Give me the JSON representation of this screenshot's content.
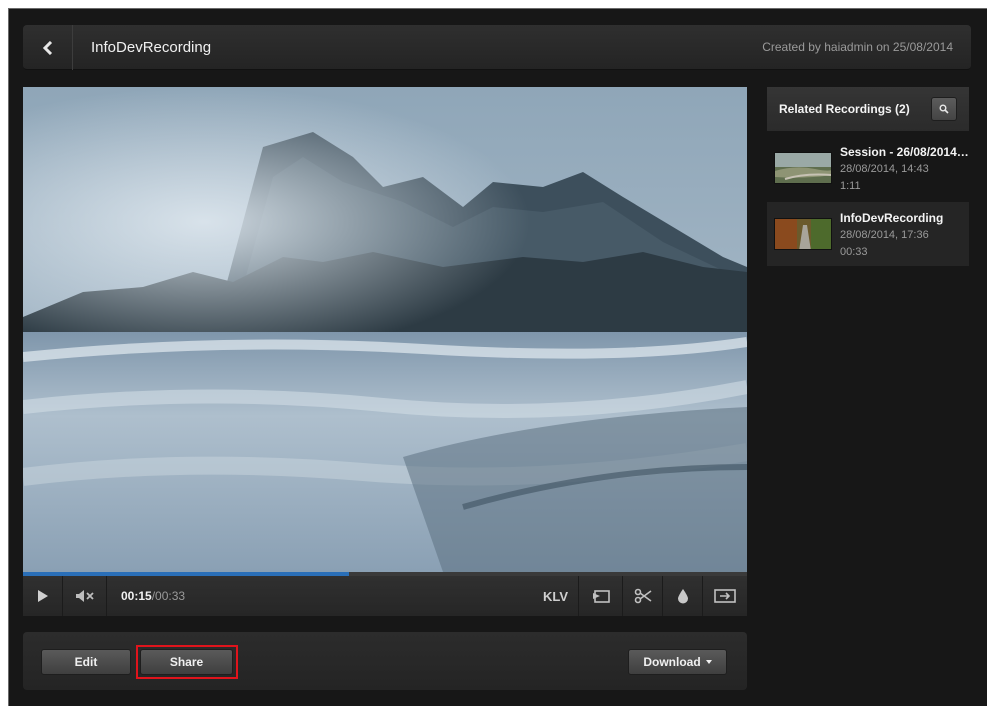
{
  "header": {
    "title": "InfoDevRecording",
    "created_by": "Created by haiadmin on 25/08/2014"
  },
  "player": {
    "current_time": "00:15",
    "separator": " / ",
    "total_time": "00:33",
    "progress_fraction": 0.45,
    "klv_label": "KLV",
    "icons": [
      "play-icon",
      "mute-icon",
      "snapshot-icon",
      "scissors-icon",
      "drop-icon",
      "fullscreen-icon"
    ]
  },
  "actions": {
    "edit_label": "Edit",
    "share_label": "Share",
    "download_label": "Download"
  },
  "related": {
    "title": "Related Recordings (2)",
    "items": [
      {
        "name": "Session - 26/08/2014,...",
        "date": "28/08/2014, 14:43",
        "duration": "1:11"
      },
      {
        "name": "InfoDevRecording",
        "date": "28/08/2014, 17:36",
        "duration": "00:33"
      }
    ]
  },
  "colors": {
    "accent": "#2a6fb8",
    "highlight": "#e0141c",
    "background": "#171717"
  }
}
